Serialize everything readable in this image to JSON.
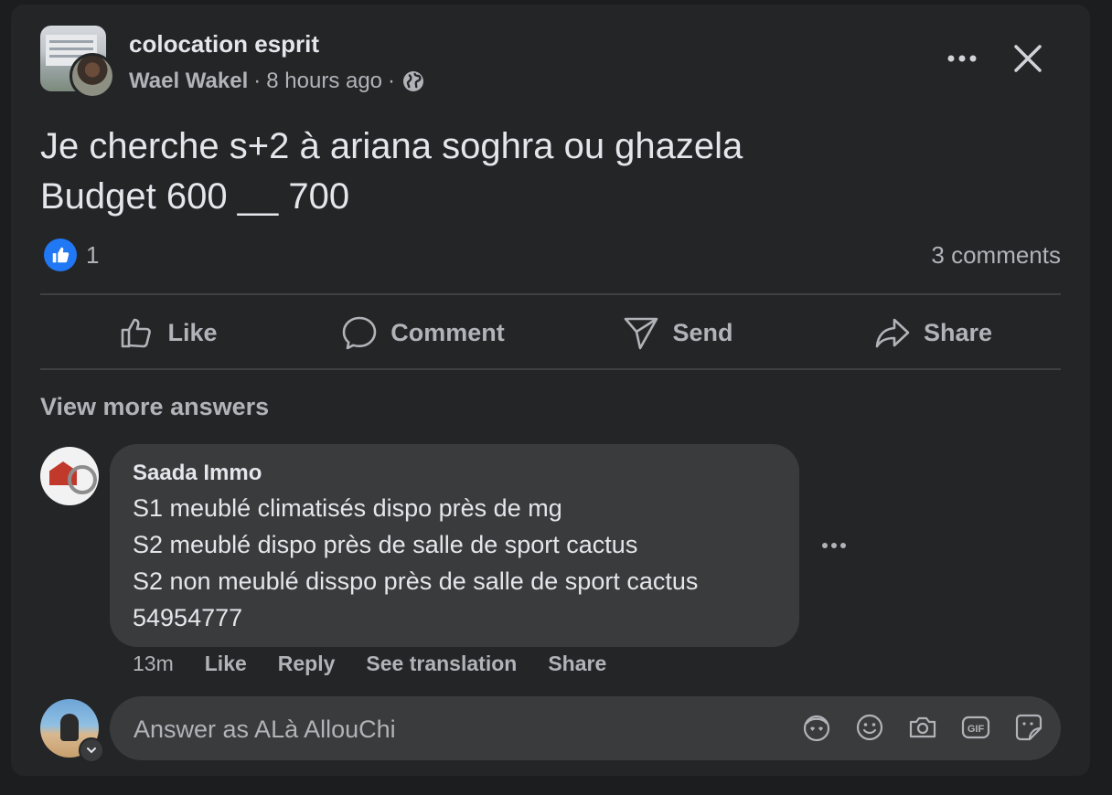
{
  "post": {
    "group_name": "colocation esprit",
    "author": "Wael Wakel",
    "separator": "·",
    "time": "8 hours ago",
    "text": "Je cherche s+2 à ariana soghra ou ghazela\nBudget 600 __ 700",
    "like_count": "1",
    "comment_count": "3 comments"
  },
  "actions": {
    "like": "Like",
    "comment": "Comment",
    "send": "Send",
    "share": "Share"
  },
  "view_more": "View more answers",
  "comment": {
    "author": "Saada Immo",
    "text": "S1 meublé climatisés dispo près de mg\nS2 meublé dispo près de salle de sport cactus\nS2 non meublé disspo près de salle de sport cactus\n54954777",
    "time": "13m",
    "like": "Like",
    "reply": "Reply",
    "translate": "See translation",
    "share": "Share"
  },
  "composer": {
    "placeholder": "Answer as ALà AllouChi"
  },
  "icons": {
    "globe": "globe-icon",
    "more": "more-horizontal-icon",
    "close": "close-icon",
    "like_reaction": "thumbs-up-icon",
    "avatar_sticker": "avatar-sticker-icon",
    "emoji": "emoji-icon",
    "camera": "camera-icon",
    "gif": "gif-icon",
    "sticker": "sticker-icon"
  },
  "colors": {
    "background": "#1c1d1f",
    "card": "#242527",
    "bubble": "#3a3b3c",
    "accent_blue": "#2078f4",
    "secondary_text": "#b0b3b8",
    "primary_text": "#e4e6eb"
  }
}
